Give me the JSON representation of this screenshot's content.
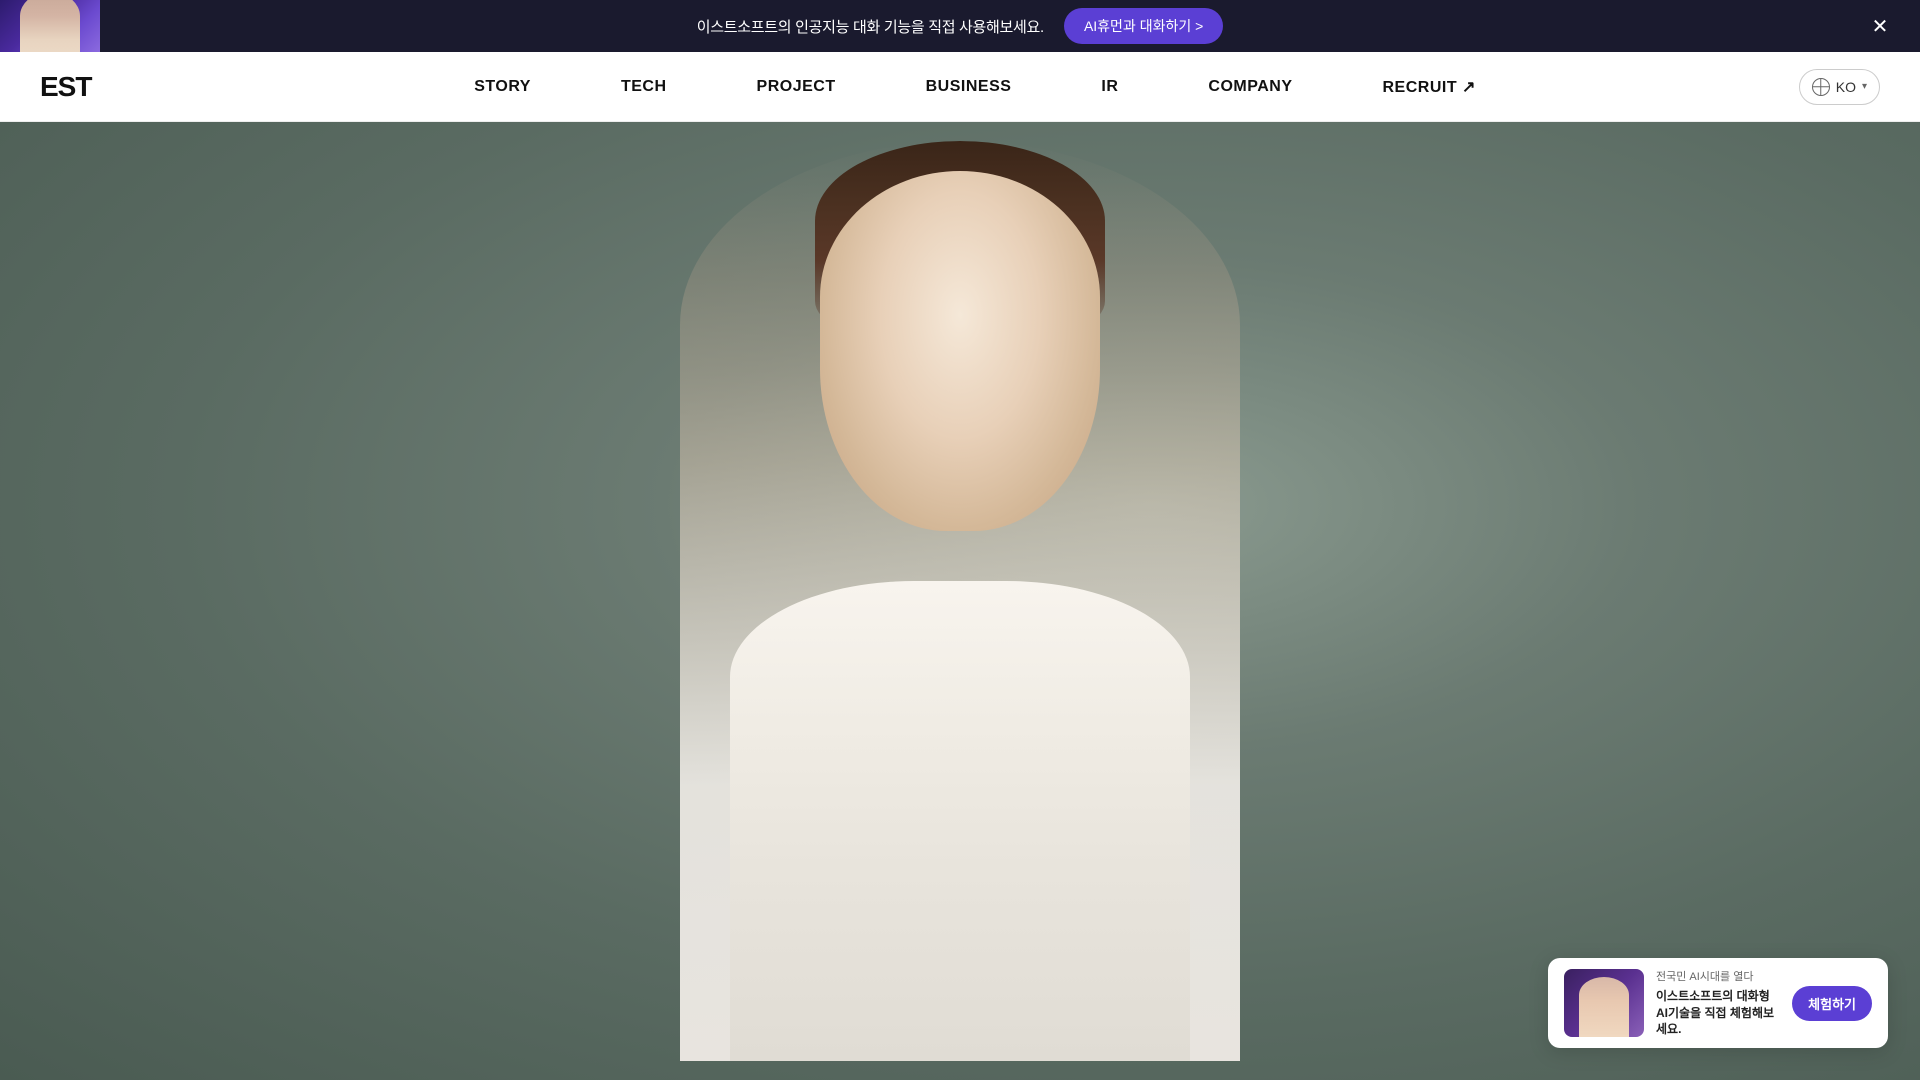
{
  "banner": {
    "text": "이스트소프트의 인공지능 대화 기능을 직접 사용해보세요.",
    "cta_label": "AI휴먼과 대화하기 >",
    "close_label": "✕"
  },
  "header": {
    "logo": "EST",
    "nav_items": [
      {
        "id": "story",
        "label": "STORY"
      },
      {
        "id": "tech",
        "label": "TECH"
      },
      {
        "id": "project",
        "label": "PROJECT"
      },
      {
        "id": "business",
        "label": "BUSINESS"
      },
      {
        "id": "ir",
        "label": "IR"
      },
      {
        "id": "company",
        "label": "COMPANY"
      },
      {
        "id": "recruit",
        "label": "RECRUIT ↗"
      }
    ],
    "lang_label": "KO",
    "lang_chevron": "▾"
  },
  "widget": {
    "tag": "전국민 AI시대를 열다",
    "description": "이스트소프트의 대화형 AI기술을\n직접 체험해보세요.",
    "cta_label": "체험하기"
  }
}
